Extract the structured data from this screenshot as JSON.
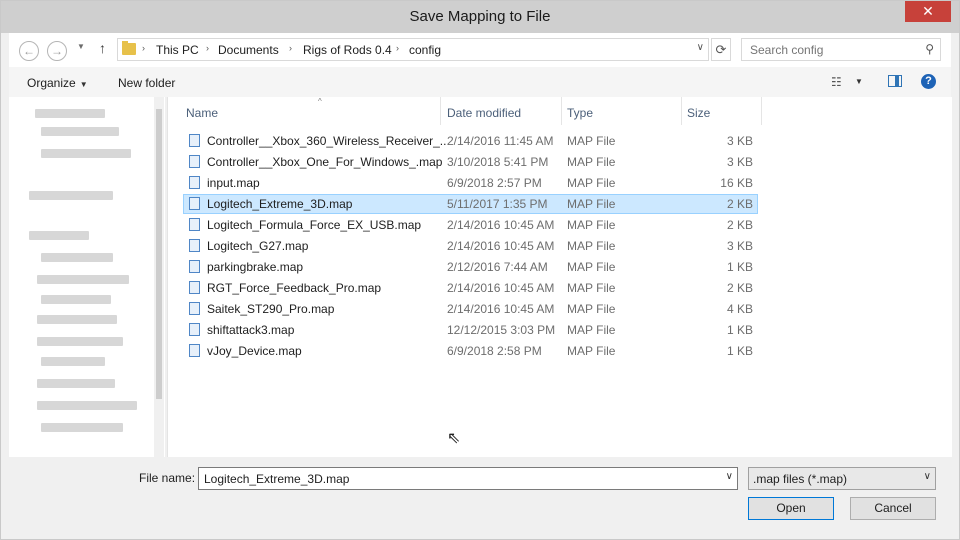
{
  "window": {
    "title": "Save Mapping to File",
    "close_glyph": "✕"
  },
  "nav": {
    "back_glyph": "←",
    "forward_glyph": "→",
    "recent_glyph": "▼",
    "up_glyph": "↑",
    "breadcrumbs": [
      "This PC",
      "Documents",
      "Rigs of Rods 0.4",
      "config"
    ],
    "separator_glyph": "›",
    "dropdown_glyph": "∨",
    "refresh_glyph": "⟳",
    "search_placeholder": "Search config",
    "search_glyph": "⚲"
  },
  "toolbar": {
    "organize_label": "Organize",
    "caret_glyph": "▼",
    "new_folder_label": "New folder",
    "view_glyph": "☷",
    "help_glyph": "?"
  },
  "columns": {
    "name": "Name",
    "date_modified": "Date modified",
    "type": "Type",
    "size": "Size",
    "sort_glyph": "^"
  },
  "files": [
    {
      "name": "Controller__Xbox_360_Wireless_Receiver_...",
      "date": "2/14/2016 11:45 AM",
      "type": "MAP File",
      "size": "3 KB"
    },
    {
      "name": "Controller__Xbox_One_For_Windows_.map",
      "date": "3/10/2018 5:41 PM",
      "type": "MAP File",
      "size": "3 KB"
    },
    {
      "name": "input.map",
      "date": "6/9/2018 2:57 PM",
      "type": "MAP File",
      "size": "16 KB"
    },
    {
      "name": "Logitech_Extreme_3D.map",
      "date": "5/11/2017 1:35 PM",
      "type": "MAP File",
      "size": "2 KB",
      "selected": true
    },
    {
      "name": "Logitech_Formula_Force_EX_USB.map",
      "date": "2/14/2016 10:45 AM",
      "type": "MAP File",
      "size": "2 KB"
    },
    {
      "name": "Logitech_G27.map",
      "date": "2/14/2016 10:45 AM",
      "type": "MAP File",
      "size": "3 KB"
    },
    {
      "name": "parkingbrake.map",
      "date": "2/12/2016 7:44 AM",
      "type": "MAP File",
      "size": "1 KB"
    },
    {
      "name": "RGT_Force_Feedback_Pro.map",
      "date": "2/14/2016 10:45 AM",
      "type": "MAP File",
      "size": "2 KB"
    },
    {
      "name": "Saitek_ST290_Pro.map",
      "date": "2/14/2016 10:45 AM",
      "type": "MAP File",
      "size": "4 KB"
    },
    {
      "name": "shiftattack3.map",
      "date": "12/12/2015 3:03 PM",
      "type": "MAP File",
      "size": "1 KB"
    },
    {
      "name": "vJoy_Device.map",
      "date": "6/9/2018 2:58 PM",
      "type": "MAP File",
      "size": "1 KB"
    }
  ],
  "bottom": {
    "file_name_label": "File name:",
    "file_name_value": "Logitech_Extreme_3D.map",
    "file_type_value": ".map files (*.map)",
    "dropdown_glyph": "∨",
    "open_label": "Open",
    "cancel_label": "Cancel"
  },
  "colors": {
    "selection": "#cce8ff",
    "selection_border": "#99d1ff",
    "close": "#c7413a",
    "accent": "#0078d7"
  },
  "cursor_glyph": "⇖"
}
